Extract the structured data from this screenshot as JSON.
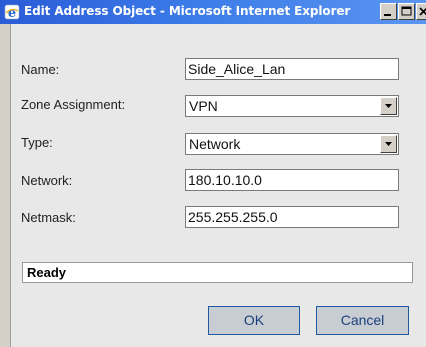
{
  "window": {
    "title": "Edit Address Object - Microsoft Internet Explorer",
    "icons": {
      "app": "ie-icon",
      "minimize": "minimize-icon",
      "maximize": "maximize-icon",
      "close": "close-icon"
    }
  },
  "form": {
    "name_label": "Name:",
    "name_value": "Side_Alice_Lan",
    "zone_label": "Zone Assignment:",
    "zone_value": "VPN",
    "type_label": "Type:",
    "type_value": "Network",
    "network_label": "Network:",
    "network_value": "180.10.10.0",
    "netmask_label": "Netmask:",
    "netmask_value": "255.255.255.0"
  },
  "status": {
    "text": "Ready"
  },
  "buttons": {
    "ok": "OK",
    "cancel": "Cancel"
  }
}
